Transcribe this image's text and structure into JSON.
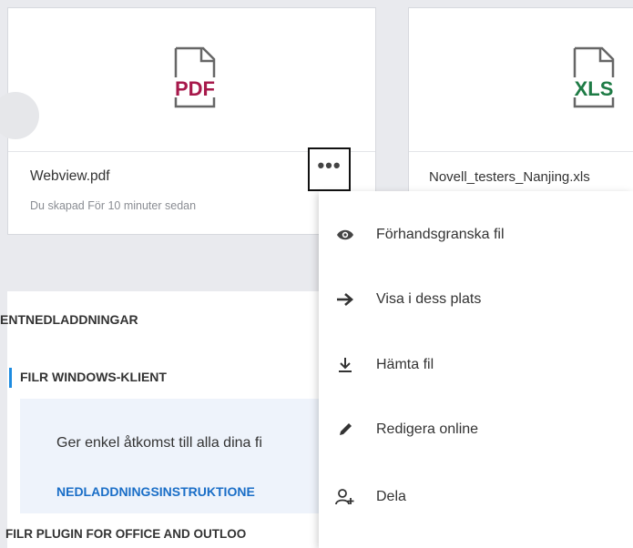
{
  "cards": [
    {
      "file_type": "PDF",
      "file_type_color": "#a7194b",
      "name": "Webview.pdf",
      "meta": "Du skapad För 10 minuter sedan"
    },
    {
      "file_type": "XLS",
      "file_type_color": "#1e7b45",
      "name": "Novell_testers_Nanjing.xls"
    }
  ],
  "more_button": {
    "label": "•••"
  },
  "downloads": {
    "title": "ENTNEDLADDNINGAR",
    "sections": [
      {
        "label": "FILR WINDOWS-KLIENT",
        "description": "Ger enkel åtkomst till alla dina fi",
        "link": "NEDLADDNINGSINSTRUKTIONE"
      },
      {
        "label": "FILR PLUGIN FOR OFFICE AND OUTLOO"
      }
    ]
  },
  "context_menu": {
    "items": [
      {
        "label": "Förhandsgranska fil",
        "icon": "eye-icon"
      },
      {
        "label": "Visa i dess plats",
        "icon": "arrow-right-icon"
      },
      {
        "label": "Hämta fil",
        "icon": "download-icon"
      },
      {
        "label": "Redigera online",
        "icon": "pencil-icon"
      },
      {
        "label": "Dela",
        "icon": "share-user-icon"
      }
    ]
  },
  "colors": {
    "accent": "#1d8be0",
    "link": "#1a6ec7",
    "background": "#e9eaee"
  }
}
